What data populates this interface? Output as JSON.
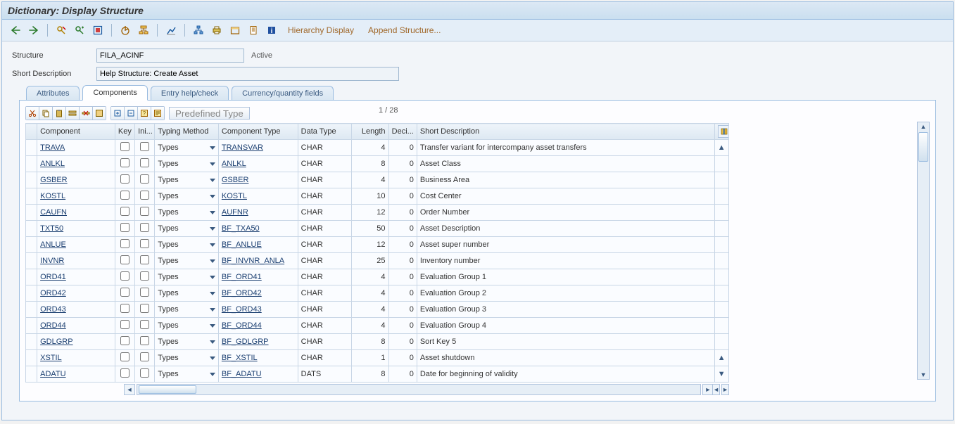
{
  "title": "Dictionary: Display Structure",
  "toolbar": {
    "hierarchy": "Hierarchy Display",
    "append": "Append Structure..."
  },
  "form": {
    "structure_label": "Structure",
    "structure_value": "FILA_ACINF",
    "status": "Active",
    "shortdesc_label": "Short Description",
    "shortdesc_value": "Help Structure: Create Asset"
  },
  "tabs": {
    "attributes": "Attributes",
    "components": "Components",
    "entryhelp": "Entry help/check",
    "currency": "Currency/quantity fields"
  },
  "mini": {
    "predefined": "Predefined Type",
    "page": "1  /  28"
  },
  "columns": {
    "component": "Component",
    "key": "Key",
    "ini": "Ini...",
    "typing": "Typing Method",
    "ctype": "Component Type",
    "dtype": "Data Type",
    "length": "Length",
    "deci": "Deci...",
    "desc": "Short Description"
  },
  "rows": [
    {
      "comp": "TRAVA",
      "typing": "Types",
      "ctype": "TRANSVAR",
      "dtype": "CHAR",
      "len": "4",
      "dec": "0",
      "desc": "Transfer variant for intercompany asset transfers"
    },
    {
      "comp": "ANLKL",
      "typing": "Types",
      "ctype": "ANLKL",
      "dtype": "CHAR",
      "len": "8",
      "dec": "0",
      "desc": "Asset Class"
    },
    {
      "comp": "GSBER",
      "typing": "Types",
      "ctype": "GSBER",
      "dtype": "CHAR",
      "len": "4",
      "dec": "0",
      "desc": "Business Area"
    },
    {
      "comp": "KOSTL",
      "typing": "Types",
      "ctype": "KOSTL",
      "dtype": "CHAR",
      "len": "10",
      "dec": "0",
      "desc": "Cost Center"
    },
    {
      "comp": "CAUFN",
      "typing": "Types",
      "ctype": "AUFNR",
      "dtype": "CHAR",
      "len": "12",
      "dec": "0",
      "desc": "Order Number"
    },
    {
      "comp": "TXT50",
      "typing": "Types",
      "ctype": "BF_TXA50",
      "dtype": "CHAR",
      "len": "50",
      "dec": "0",
      "desc": "Asset Description"
    },
    {
      "comp": "ANLUE",
      "typing": "Types",
      "ctype": "BF_ANLUE",
      "dtype": "CHAR",
      "len": "12",
      "dec": "0",
      "desc": "Asset super number"
    },
    {
      "comp": "INVNR",
      "typing": "Types",
      "ctype": "BF_INVNR_ANLA",
      "dtype": "CHAR",
      "len": "25",
      "dec": "0",
      "desc": "Inventory number"
    },
    {
      "comp": "ORD41",
      "typing": "Types",
      "ctype": "BF_ORD41",
      "dtype": "CHAR",
      "len": "4",
      "dec": "0",
      "desc": "Evaluation Group 1"
    },
    {
      "comp": "ORD42",
      "typing": "Types",
      "ctype": "BF_ORD42",
      "dtype": "CHAR",
      "len": "4",
      "dec": "0",
      "desc": "Evaluation Group 2"
    },
    {
      "comp": "ORD43",
      "typing": "Types",
      "ctype": "BF_ORD43",
      "dtype": "CHAR",
      "len": "4",
      "dec": "0",
      "desc": "Evaluation Group 3"
    },
    {
      "comp": "ORD44",
      "typing": "Types",
      "ctype": "BF_ORD44",
      "dtype": "CHAR",
      "len": "4",
      "dec": "0",
      "desc": "Evaluation Group 4"
    },
    {
      "comp": "GDLGRP",
      "typing": "Types",
      "ctype": "BF_GDLGRP",
      "dtype": "CHAR",
      "len": "8",
      "dec": "0",
      "desc": "Sort Key 5"
    },
    {
      "comp": "XSTIL",
      "typing": "Types",
      "ctype": "BF_XSTIL",
      "dtype": "CHAR",
      "len": "1",
      "dec": "0",
      "desc": "Asset shutdown"
    },
    {
      "comp": "ADATU",
      "typing": "Types",
      "ctype": "BF_ADATU",
      "dtype": "DATS",
      "len": "8",
      "dec": "0",
      "desc": "Date for beginning of validity"
    }
  ]
}
